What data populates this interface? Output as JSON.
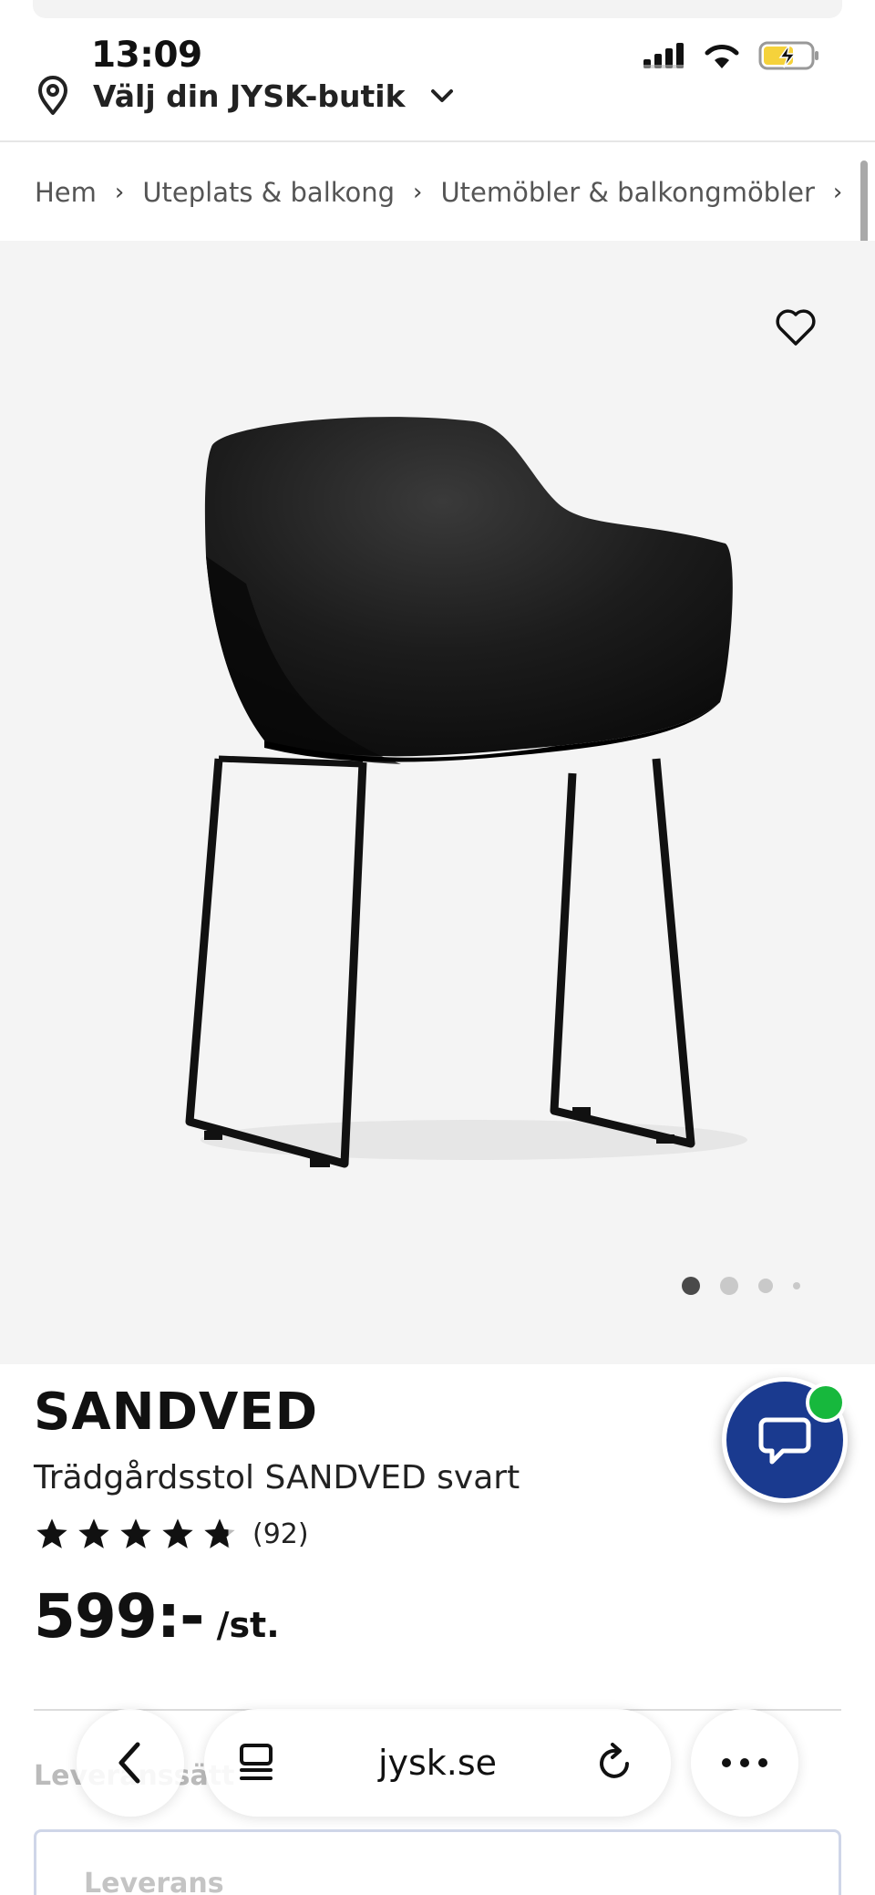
{
  "status_bar": {
    "time": "13:09"
  },
  "store_selector": {
    "label": "Välj din JYSK-butik"
  },
  "breadcrumb": {
    "items": [
      "Hem",
      "Uteplats & balkong",
      "Utemöbler & balkongmöbler"
    ],
    "separator": "›"
  },
  "gallery": {
    "image_count": 4,
    "active_index": 0
  },
  "product": {
    "name": "SANDVED",
    "description": "Trädgårdsstol SANDVED svart",
    "rating": 4.8,
    "rating_count": "(92)",
    "price": "599:-",
    "price_unit": "/st."
  },
  "delivery": {
    "section_label": "Leveranssätt",
    "option_label": "Leverans"
  },
  "browser_toolbar": {
    "url": "jysk.se"
  },
  "colors": {
    "chat_button": "#1a3a8f",
    "online_indicator": "#17b83d",
    "battery_fill": "#f5d23b",
    "image_background": "#f4f4f4"
  }
}
